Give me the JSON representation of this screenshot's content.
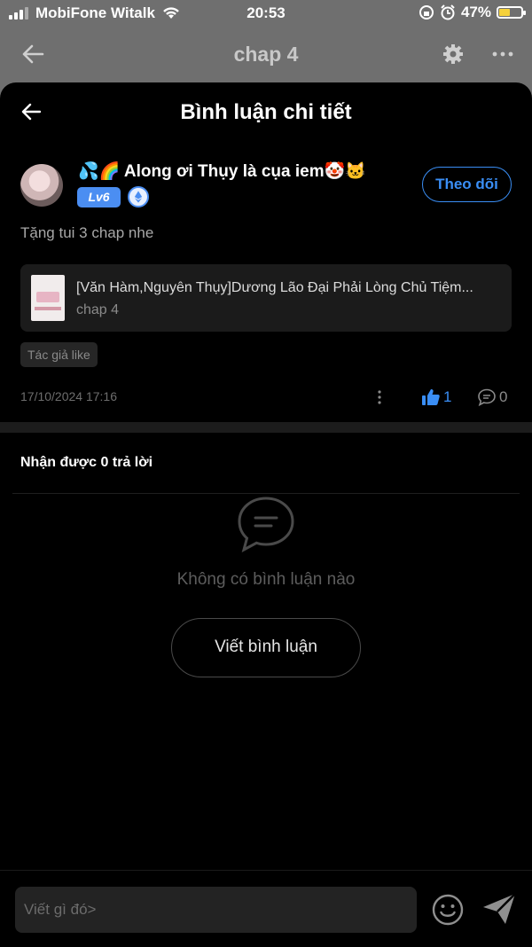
{
  "status_bar": {
    "carrier": "MobiFone Witalk",
    "time": "20:53",
    "battery": "47%"
  },
  "underlying_nav": {
    "title": "chap 4"
  },
  "sheet": {
    "title": "Bình luận chi tiết"
  },
  "comment": {
    "username": "💦🌈 Along ơi Thụy là cụa iem🤡🐱",
    "level": "Lv6",
    "follow_label": "Theo dõi",
    "text": "Tặng tui 3 chap nhe",
    "chapter_card": {
      "title": "[Văn Hàm,Nguyên Thụy]Dương Lão Đại Phải Lòng Chủ Tiệm...",
      "subtitle": "chap 4"
    },
    "tag": "Tác giả like",
    "date": "17/10/2024 17:16",
    "likes": "1",
    "replies": "0"
  },
  "replies_section": {
    "header": "Nhận được 0 trả lời",
    "empty_text": "Không có bình luận nào",
    "write_button": "Viết bình luận"
  },
  "input_bar": {
    "placeholder": "Viết gì đó>"
  },
  "colors": {
    "accent": "#3a8ef5",
    "battery": "#f5d13b",
    "background": "#000000"
  }
}
